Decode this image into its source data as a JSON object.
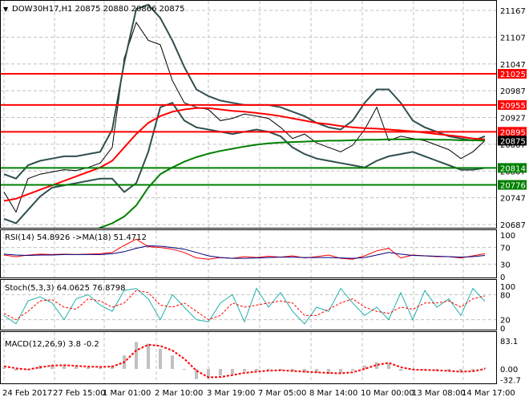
{
  "chart_data": [
    {
      "type": "line",
      "title": "DOW30H17,H1  20875 20880 20866 20875",
      "ylim": [
        20687,
        21167
      ],
      "yticks": [
        "21167",
        "21107",
        "21047",
        "20987",
        "20927",
        "20867",
        "20807",
        "20747",
        "20687"
      ],
      "xticks": [
        "24 Feb 2017",
        "27 Feb 15:00",
        "1 Mar 01:00",
        "2 Mar 10:00",
        "3 Mar 19:00",
        "7 Mar 05:00",
        "8 Mar 14:00",
        "10 Mar 00:00",
        "13 Mar 08:00",
        "14 Mar 17:00"
      ],
      "levels": [
        {
          "value": 21025,
          "label": "21025",
          "color": "#ff0000"
        },
        {
          "value": 20955,
          "label": "20955",
          "color": "#ff0000"
        },
        {
          "value": 20895,
          "label": "20895",
          "color": "#ff0000"
        },
        {
          "value": 20814,
          "label": "20814",
          "color": "#008000"
        },
        {
          "value": 20776,
          "label": "20776",
          "color": "#008000"
        }
      ],
      "current": {
        "value": 20875,
        "label": "20875"
      },
      "series": [
        {
          "name": "close",
          "color": "#000000",
          "values": [
            20760,
            20715,
            20790,
            20800,
            20805,
            20810,
            20808,
            20815,
            20825,
            20860,
            21060,
            21140,
            21100,
            21090,
            21010,
            20960,
            20950,
            20945,
            20920,
            20925,
            20935,
            20930,
            20925,
            20905,
            20880,
            20890,
            20870,
            20860,
            20850,
            20865,
            20900,
            20950,
            20875,
            20885,
            20880,
            20875,
            20865,
            20855,
            20835,
            20850,
            20875
          ]
        },
        {
          "name": "bb-upper",
          "color": "#2f4f4f",
          "values": [
            20800,
            20790,
            20820,
            20830,
            20835,
            20840,
            20840,
            20845,
            20850,
            20900,
            21050,
            21170,
            21180,
            21150,
            21100,
            21040,
            20990,
            20975,
            20965,
            20960,
            20955,
            20955,
            20955,
            20950,
            20940,
            20930,
            20915,
            20905,
            20900,
            20920,
            20960,
            20990,
            20990,
            20960,
            20920,
            20905,
            20895,
            20885,
            20880,
            20875,
            20885
          ]
        },
        {
          "name": "bb-lower",
          "color": "#2f4f4f",
          "values": [
            20700,
            20690,
            20720,
            20750,
            20770,
            20775,
            20780,
            20785,
            20790,
            20790,
            20760,
            20780,
            20850,
            20950,
            20960,
            20920,
            20905,
            20900,
            20895,
            20890,
            20895,
            20900,
            20895,
            20885,
            20860,
            20845,
            20835,
            20830,
            20825,
            20820,
            20815,
            20830,
            20840,
            20845,
            20850,
            20840,
            20830,
            20820,
            20810,
            20810,
            20814
          ]
        },
        {
          "name": "ma-red",
          "color": "#ff0000",
          "values": [
            20740,
            20745,
            20755,
            20765,
            20775,
            20785,
            20795,
            20805,
            20815,
            20830,
            20860,
            20890,
            20915,
            20930,
            20940,
            20945,
            20948,
            20948,
            20945,
            20942,
            20940,
            20937,
            20934,
            20930,
            20925,
            20920,
            20915,
            20912,
            20908,
            20905,
            20903,
            20902,
            20900,
            20898,
            20896,
            20893,
            20890,
            20887,
            20884,
            20880,
            20878
          ]
        },
        {
          "name": "ma-green",
          "color": "#008000",
          "values": [
            20560,
            20575,
            20590,
            20605,
            20620,
            20635,
            20650,
            20665,
            20680,
            20690,
            20705,
            20730,
            20770,
            20800,
            20815,
            20828,
            20838,
            20846,
            20852,
            20857,
            20862,
            20866,
            20869,
            20871,
            20872,
            20873,
            20874,
            20875,
            20875,
            20876,
            20877,
            20877,
            20878,
            20878,
            20878,
            20878,
            20877,
            20877,
            20876,
            20876,
            20875
          ]
        }
      ]
    },
    {
      "type": "line",
      "title": "RSI(14) 54.8926  ->MA(18) 51.4712",
      "ylim": [
        0,
        100
      ],
      "yticks": [
        "100",
        "70",
        "30",
        "0"
      ],
      "tickvals": [
        100,
        70,
        30,
        0
      ],
      "series": [
        {
          "name": "rsi",
          "color": "#ff0000",
          "values": [
            52,
            48,
            52,
            54,
            53,
            54,
            53,
            54,
            55,
            58,
            75,
            90,
            72,
            70,
            66,
            58,
            45,
            42,
            46,
            44,
            48,
            46,
            49,
            47,
            50,
            45,
            48,
            52,
            44,
            42,
            50,
            62,
            68,
            45,
            52,
            50,
            48,
            48,
            45,
            50,
            55
          ]
        },
        {
          "name": "rsi-ma",
          "color": "#000080",
          "values": [
            54,
            52,
            51,
            52,
            52,
            53,
            53,
            53,
            53,
            55,
            60,
            68,
            74,
            73,
            70,
            66,
            58,
            50,
            46,
            44,
            44,
            45,
            46,
            47,
            47,
            46,
            46,
            46,
            45,
            44,
            46,
            52,
            58,
            54,
            51,
            50,
            49,
            48,
            47,
            48,
            51
          ]
        }
      ]
    },
    {
      "type": "line",
      "title": "Stoch(5,3,3) 64.0625 76.8798",
      "ylim": [
        0,
        100
      ],
      "yticks": [
        "100",
        "80",
        "20",
        "0"
      ],
      "tickvals": [
        100,
        80,
        20,
        0
      ],
      "series": [
        {
          "name": "stoch-main",
          "color": "#20b2aa",
          "values": [
            30,
            10,
            65,
            75,
            60,
            20,
            70,
            80,
            55,
            40,
            90,
            95,
            70,
            20,
            80,
            50,
            20,
            15,
            60,
            80,
            15,
            95,
            50,
            85,
            40,
            10,
            50,
            40,
            95,
            60,
            30,
            50,
            20,
            85,
            20,
            90,
            50,
            70,
            30,
            95,
            64
          ]
        },
        {
          "name": "stoch-signal",
          "color": "#ff0000",
          "values": [
            35,
            20,
            40,
            65,
            68,
            50,
            45,
            70,
            65,
            50,
            60,
            90,
            85,
            55,
            50,
            60,
            40,
            20,
            30,
            60,
            50,
            55,
            60,
            65,
            60,
            30,
            30,
            45,
            60,
            70,
            50,
            40,
            35,
            50,
            45,
            60,
            60,
            65,
            50,
            70,
            77
          ]
        }
      ]
    },
    {
      "type": "bar",
      "title": "MACD(12,26,9) 3.8 -0.2",
      "ylim": [
        -32.7,
        83.1
      ],
      "yticks": [
        "83.1",
        "0.00",
        "-32.7"
      ],
      "tickvals": [
        83.1,
        0,
        -32.7
      ],
      "series": [
        {
          "name": "macd-hist",
          "color": "#c0c0c0",
          "values": [
            5,
            -5,
            0,
            10,
            12,
            10,
            8,
            5,
            5,
            10,
            40,
            80,
            75,
            60,
            40,
            0,
            -30,
            -28,
            -20,
            -15,
            -8,
            -5,
            -2,
            -5,
            -8,
            -10,
            -12,
            -15,
            -12,
            -5,
            10,
            20,
            15,
            -5,
            -2,
            -3,
            -5,
            -8,
            -10,
            -6,
            3.8
          ]
        },
        {
          "name": "macd-signal",
          "color": "#ff0000",
          "values": [
            8,
            2,
            -2,
            5,
            10,
            11,
            9,
            7,
            6,
            7,
            20,
            55,
            72,
            68,
            55,
            30,
            -5,
            -25,
            -24,
            -18,
            -12,
            -8,
            -5,
            -4,
            -6,
            -8,
            -10,
            -12,
            -13,
            -10,
            0,
            12,
            18,
            5,
            -2,
            -3,
            -4,
            -6,
            -8,
            -7,
            -0.2
          ]
        }
      ]
    }
  ]
}
